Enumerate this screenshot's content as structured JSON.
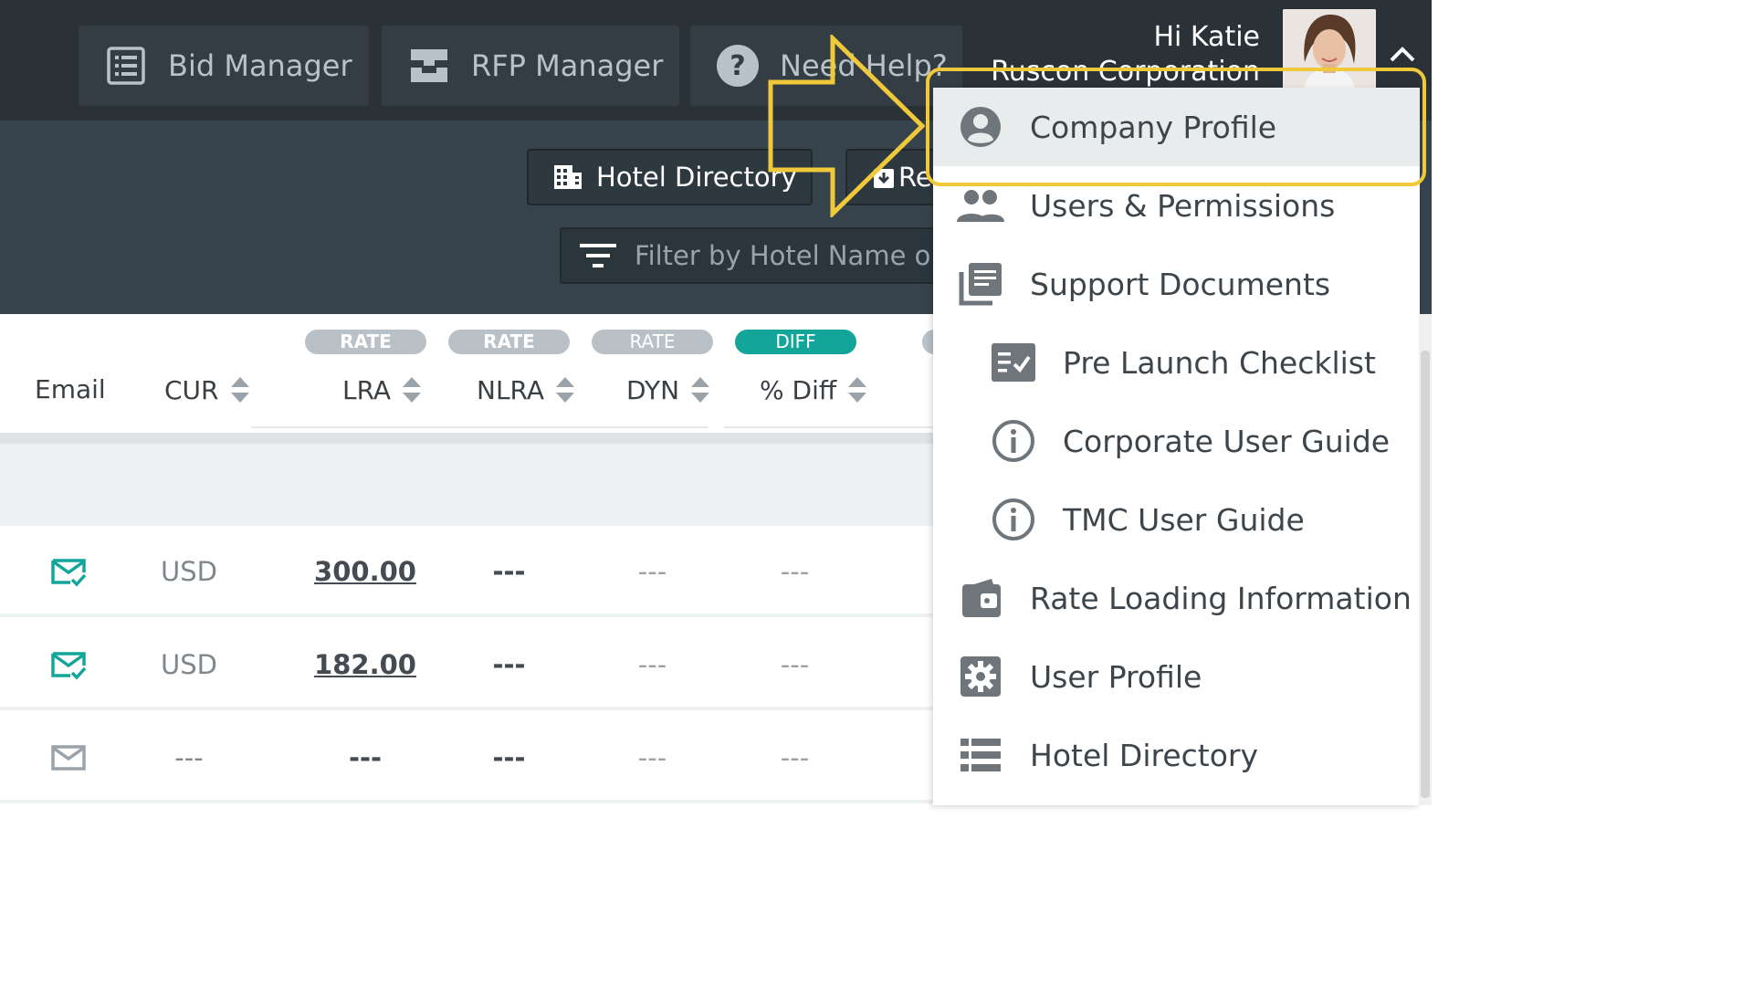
{
  "topnav": {
    "buttons": [
      {
        "label": "Bid Manager",
        "icon": "list-icon"
      },
      {
        "label": "RFP Manager",
        "icon": "inbox-icon"
      },
      {
        "label": "Need Help?",
        "icon": "question-icon"
      }
    ],
    "greeting": "Hi Katie",
    "company": "Ruscon Corporation"
  },
  "subheader": {
    "hotel_directory_label": "Hotel Directory",
    "reports_label": "Re",
    "filter_placeholder": "Filter by Hotel Name or S"
  },
  "table": {
    "pills": [
      {
        "label": "RATE",
        "color": "#b9c1c6"
      },
      {
        "label": "RATE",
        "color": "#b9c1c6"
      },
      {
        "label": "RATE",
        "color": "#b9c1c6"
      },
      {
        "label": "DIFF",
        "color": "#13a59a"
      }
    ],
    "headers": {
      "email": "Email",
      "cur": "CUR",
      "lra": "LRA",
      "nlra": "NLRA",
      "dyn": "DYN",
      "diff": "% Diff"
    },
    "rows": [
      {
        "email_status": "sent",
        "cur": "USD",
        "lra": "300.00",
        "nlra": "---",
        "dyn": "---",
        "diff": "---"
      },
      {
        "email_status": "sent",
        "cur": "USD",
        "lra": "182.00",
        "nlra": "---",
        "dyn": "---",
        "diff": "---"
      },
      {
        "email_status": "none",
        "cur": "---",
        "lra": "---",
        "nlra": "---",
        "dyn": "---",
        "diff": "---"
      }
    ]
  },
  "menu": {
    "items": [
      {
        "label": "Company Profile",
        "icon": "user-circle-icon"
      },
      {
        "label": "Users & Permissions",
        "icon": "users-icon"
      },
      {
        "label": "Support Documents",
        "icon": "documents-icon"
      },
      {
        "label": "Pre Launch Checklist",
        "icon": "checklist-icon"
      },
      {
        "label": "Corporate User Guide",
        "icon": "info-icon"
      },
      {
        "label": "TMC User Guide",
        "icon": "info-icon"
      },
      {
        "label": "Rate Loading Information",
        "icon": "wallet-icon"
      },
      {
        "label": "User Profile",
        "icon": "gear-icon"
      },
      {
        "label": "Hotel Directory",
        "icon": "list-icon"
      }
    ]
  },
  "colors": {
    "accent_teal": "#13a59a",
    "highlight_yellow": "#f0c93a",
    "nav_bg": "#2a3238"
  }
}
